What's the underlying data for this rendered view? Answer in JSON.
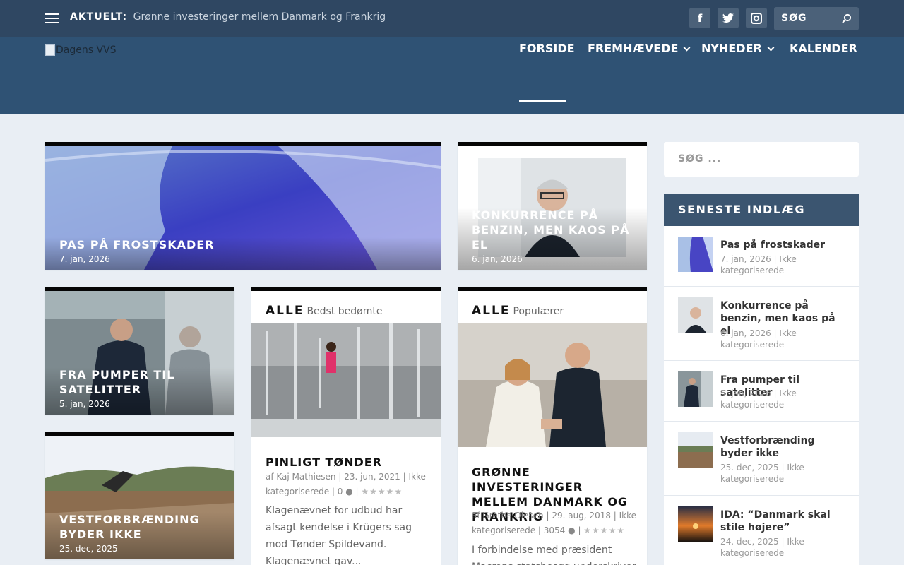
{
  "topbar": {
    "ticker_label": "AKTUELT:",
    "ticker_text": "Grønne investeringer mellem Danmark og Frankrig",
    "search_placeholder": "SØG",
    "social": [
      {
        "icon": "facebook-icon",
        "glyph": "f"
      },
      {
        "icon": "twitter-icon",
        "glyph": "t"
      },
      {
        "icon": "instagram-icon",
        "glyph": "◘"
      }
    ]
  },
  "header": {
    "logo_alt": "Dagens VVS",
    "nav": [
      {
        "label": "FORSIDE",
        "active": true
      },
      {
        "label": "FREMHÆVEDE",
        "dropdown": true
      },
      {
        "label": "NYHEDER",
        "dropdown": true
      },
      {
        "label": "KALENDER"
      }
    ]
  },
  "featured": [
    {
      "title": "PAS PÅ FROSTSKADER",
      "date": "7. jan, 2026"
    },
    {
      "title": "KONKURRENCE PÅ BENZIN, MEN KAOS PÅ EL",
      "date": "6. jan, 2026"
    },
    {
      "title": "FRA PUMPER TIL SATELITTER",
      "date": "5. jan, 2026"
    },
    {
      "title": "VESTFORBRÆNDING BYDER IKKE",
      "date": "25. dec, 2025"
    }
  ],
  "top_rated": {
    "heading": "ALLE",
    "subheading": "Bedst bedømte",
    "title": "PINLIGT TØNDER",
    "meta_line1": "af Kaj Mathiesen | 23. jun, 2021 | Ikke",
    "meta_line2_prefix": "kategoriserede | 0",
    "excerpt": "Klagenævnet for udbud har afsagt kendelse i Krügers sag mod Tønder Spildevand. Klagenævnet gav..."
  },
  "popular": {
    "heading": "ALLE",
    "subheading": "Populærer",
    "title": "GRØNNE INVESTERINGER MELLEM DANMARK OG FRANKRIG",
    "meta_line1": "af Grethe Olesen | 29. aug, 2018 | Ikke",
    "meta_line2_prefix": "kategoriserede | 3054",
    "excerpt": "I forbindelse med præsident Macrons statsbesøg underskriver"
  },
  "sidebar": {
    "search_placeholder": "SØG ...",
    "recent_heading": "SENESTE INDLÆG",
    "recent": [
      {
        "title": "Pas på frostskader",
        "meta": "7. jan, 2026 | Ikke kategoriserede"
      },
      {
        "title": "Konkurrence på benzin, men kaos på el",
        "meta": "6. jan, 2026 | Ikke kategoriserede"
      },
      {
        "title": "Fra pumper til satelitter",
        "meta": "5. jan, 2026 | Ikke kategoriserede"
      },
      {
        "title": "Vestforbrænding byder ikke",
        "meta": "25. dec, 2025 | Ikke kategoriserede"
      },
      {
        "title": "IDA: “Danmark skal stile højere”",
        "meta": "24. dec, 2025 | Ikke kategoriserede"
      }
    ]
  },
  "colors": {
    "topbar": "#2f4762",
    "header": "#2f5274",
    "page_bg": "#e9eef4",
    "card_border": "#050505"
  }
}
